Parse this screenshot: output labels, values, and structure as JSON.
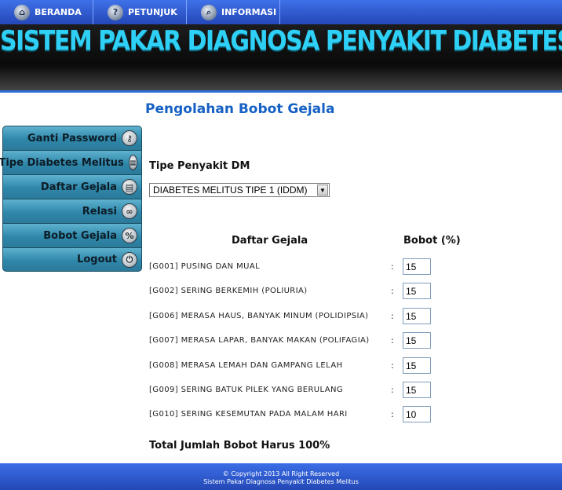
{
  "nav": {
    "items": [
      {
        "label": "BERANDA",
        "icon": "home-icon"
      },
      {
        "label": "PETUNJUK",
        "icon": "question-icon"
      },
      {
        "label": "INFORMASI",
        "icon": "search-icon"
      }
    ]
  },
  "banner": {
    "title": "SISTEM PAKAR DIAGNOSA PENYAKIT DIABETES MELITUS"
  },
  "page": {
    "title": "Pengolahan Bobot Gejala"
  },
  "sidebar": {
    "items": [
      {
        "label": "Ganti Password",
        "icon": "key-icon"
      },
      {
        "label": "Tipe Diabetes Melitus",
        "icon": "list-icon"
      },
      {
        "label": "Daftar Gejala",
        "icon": "document-icon"
      },
      {
        "label": "Relasi",
        "icon": "link-icon"
      },
      {
        "label": "Bobot Gejala",
        "icon": "percent-icon"
      },
      {
        "label": "Logout",
        "icon": "power-icon"
      }
    ]
  },
  "form": {
    "type_label": "Tipe Penyakit DM",
    "type_selected": "DIABETES MELITUS TIPE 1 (IDDM)",
    "col_symptoms": "Daftar Gejala",
    "col_weight": "Bobot (%)",
    "rows": [
      {
        "name": "[G001] PUSING DAN MUAL",
        "weight": "15"
      },
      {
        "name": "[G002] SERING BERKEMIH (POLIURIA)",
        "weight": "15"
      },
      {
        "name": "[G006] MERASA HAUS, BANYAK MINUM (POLIDIPSIA)",
        "weight": "15"
      },
      {
        "name": "[G007] MERASA LAPAR, BANYAK MAKAN (POLIFAGIA)",
        "weight": "15"
      },
      {
        "name": "[G008] MERASA LEMAH DAN GAMPANG LELAH",
        "weight": "15"
      },
      {
        "name": "[G009] SERING BATUK PILEK YANG BERULANG",
        "weight": "15"
      },
      {
        "name": "[G010] SERING KESEMUTAN PADA MALAM HARI",
        "weight": "10"
      }
    ],
    "total_note": "Total Jumlah Bobot Harus 100%"
  },
  "footer": {
    "copyright": "© Copyright 2013 All Right Reserved",
    "app_name": "Sistem Pakar Diagnosa Penyakit Diabetes Melitus"
  },
  "colors": {
    "nav_blue": "#2f5fd6",
    "title_blue": "#1560c4",
    "banner_text": "#2fd0f5",
    "sidebar_teal": "#3a93b5"
  }
}
